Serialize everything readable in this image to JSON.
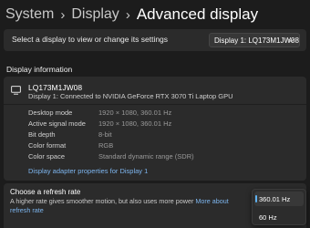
{
  "breadcrumb": {
    "level1": "System",
    "level2": "Display",
    "current": "Advanced display",
    "separator": "›"
  },
  "select_display": {
    "label": "Select a display to view or change its settings",
    "value": "Display 1: LQ173M1JW08"
  },
  "display_information": {
    "section_title": "Display information",
    "monitor_name": "LQ173M1JW08",
    "monitor_subtitle": "Display 1: Connected to NVIDIA GeForce RTX 3070 Ti Laptop GPU",
    "properties": [
      {
        "key": "Desktop mode",
        "value": "1920 × 1080, 360.01 Hz"
      },
      {
        "key": "Active signal mode",
        "value": "1920 × 1080, 360.01 Hz"
      },
      {
        "key": "Bit depth",
        "value": "8-bit"
      },
      {
        "key": "Color format",
        "value": "RGB"
      },
      {
        "key": "Color space",
        "value": "Standard dynamic range (SDR)"
      }
    ],
    "adapter_link": "Display adapter properties for Display 1"
  },
  "refresh_rate": {
    "title": "Choose a refresh rate",
    "description": "A higher rate gives smoother motion, but also uses more power",
    "more_link": "More about refresh rate",
    "options": [
      "360.01 Hz",
      "60 Hz"
    ],
    "selected": "360.01 Hz"
  },
  "icons": {
    "monitor": "monitor-icon",
    "chevron": "chevron-down-icon"
  },
  "colors": {
    "background": "#1c1c1c",
    "card": "#2b2b2b",
    "link": "#7db5ee",
    "accent": "#5fb2f2"
  }
}
